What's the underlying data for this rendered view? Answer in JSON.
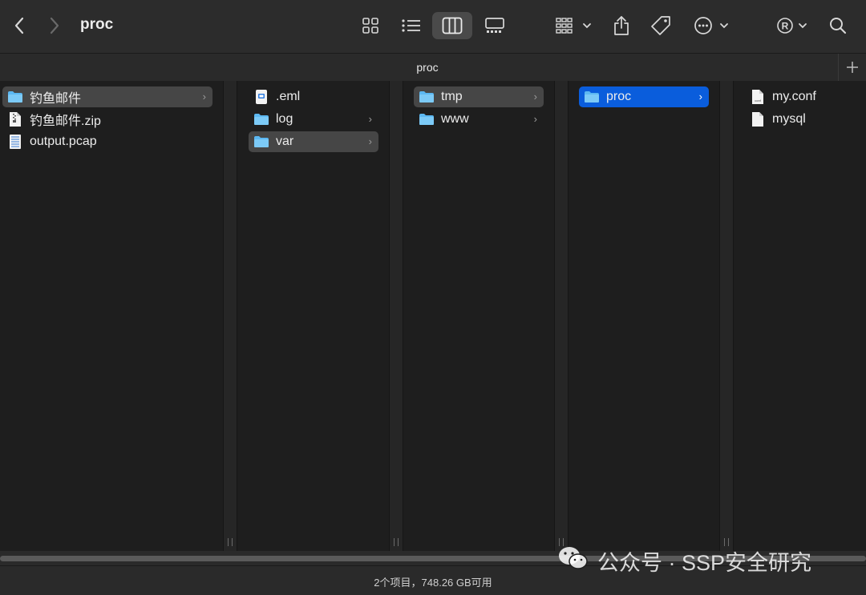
{
  "toolbar": {
    "title": "proc",
    "icons": [
      "back-icon",
      "forward-icon",
      "icon-view-icon",
      "list-view-icon",
      "column-view-icon",
      "gallery-view-icon",
      "group-icon",
      "share-icon",
      "tag-icon",
      "more-icon",
      "registered-icon",
      "search-icon"
    ]
  },
  "tab": {
    "label": "proc",
    "plus": "+"
  },
  "columns": [
    {
      "items": [
        {
          "label": "钓鱼邮件",
          "type": "folder",
          "selected": "gray",
          "chevron": "›"
        },
        {
          "label": "钓鱼邮件.zip",
          "type": "zip"
        },
        {
          "label": "output.pcap",
          "type": "pcap"
        }
      ]
    },
    {
      "items": [
        {
          "label": ".eml",
          "type": "eml"
        },
        {
          "label": "log",
          "type": "folder",
          "chevron": "›"
        },
        {
          "label": "var",
          "type": "folder",
          "selected": "gray",
          "chevron": "›"
        }
      ]
    },
    {
      "items": [
        {
          "label": "tmp",
          "type": "folder",
          "selected": "gray",
          "chevron": "›"
        },
        {
          "label": "www",
          "type": "folder",
          "chevron": "›"
        }
      ]
    },
    {
      "items": [
        {
          "label": "proc",
          "type": "folder",
          "selected": "blue",
          "chevron": "›"
        }
      ]
    },
    {
      "items": [
        {
          "label": "my.conf",
          "type": "conf"
        },
        {
          "label": "mysql",
          "type": "file"
        }
      ]
    }
  ],
  "status": {
    "text": "2个项目，748.26 GB可用"
  },
  "watermark": {
    "text": "公众号 · SSP安全研究"
  },
  "colors": {
    "accent": "#0a5ddc",
    "folder": "#5cb8f2",
    "background": "#1e1e1e"
  }
}
